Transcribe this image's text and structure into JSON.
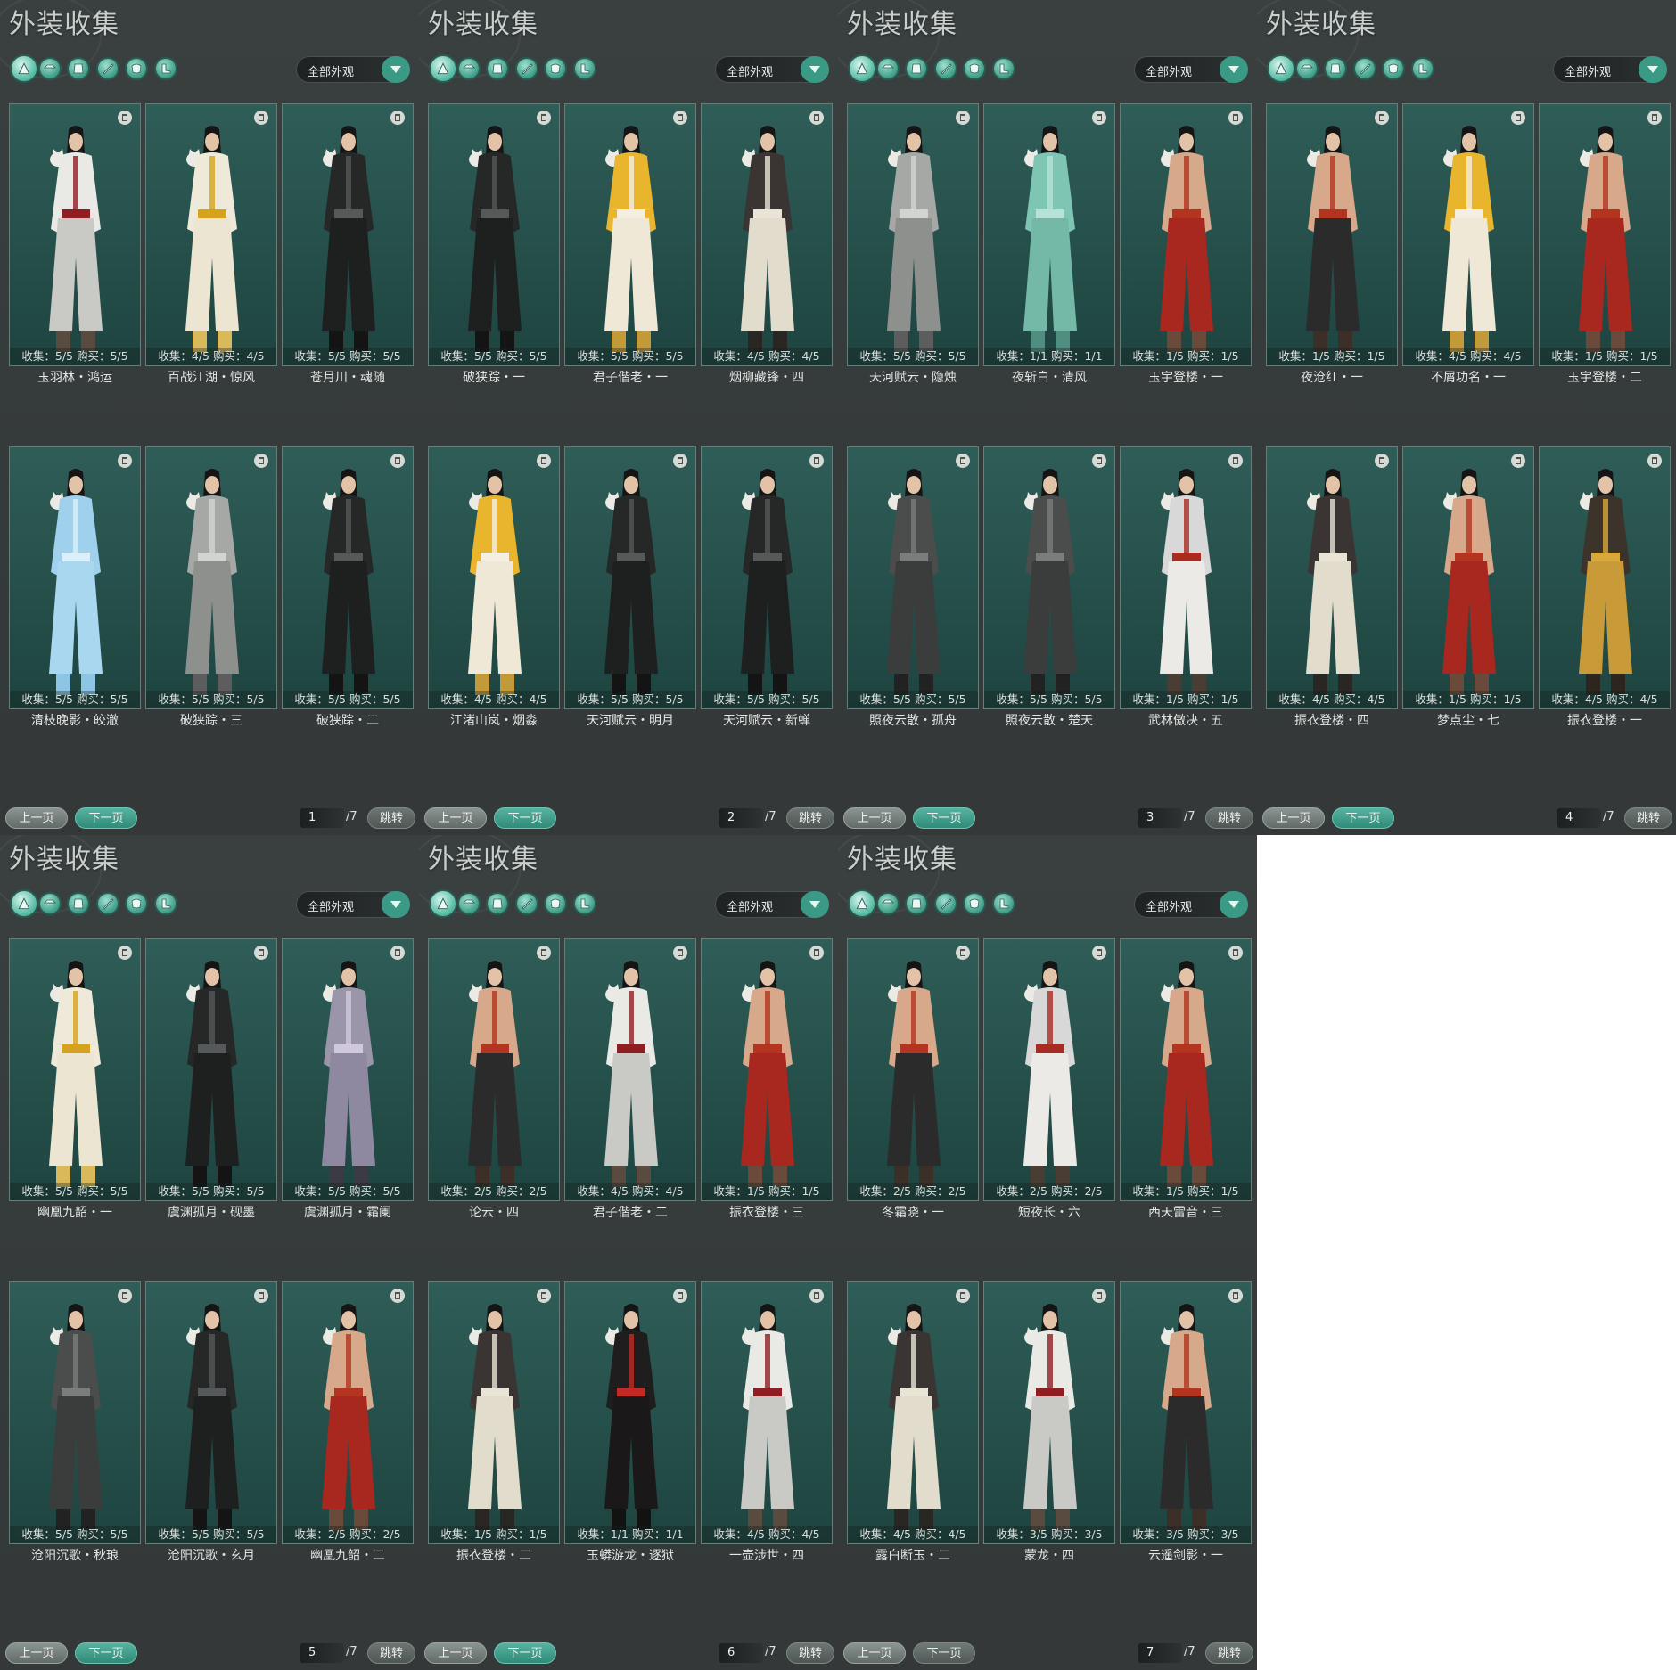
{
  "panel_title": "外装收集",
  "filter_label": "全部外观",
  "prev_label": "上一页",
  "next_label": "下一页",
  "jump_label": "跳转",
  "filter_icons": [
    "all-outfits-icon",
    "hat-icon",
    "top-icon",
    "weapon-icon",
    "mask-icon",
    "shoes-icon"
  ],
  "colors": {
    "accent": "#3a9a86",
    "card_bg": "#2f5d57",
    "panel_bg": "#3a4040"
  },
  "panels": [
    {
      "page": "1",
      "total": "/7",
      "items": [
        {
          "name": "玉羽林・鸿运",
          "collect": "收集：5/5",
          "buy": "购买：5/5",
          "outfit": "white"
        },
        {
          "name": "百战江湖・惊风",
          "collect": "收集：4/5",
          "buy": "购买：4/5",
          "outfit": "whitegold"
        },
        {
          "name": "苍月川・魂随",
          "collect": "收集：5/5",
          "buy": "购买：5/5",
          "outfit": "black"
        },
        {
          "name": "清枝晚影・皎澈",
          "collect": "收集：5/5",
          "buy": "购买：5/5",
          "outfit": "blue"
        },
        {
          "name": "破狭踪・三",
          "collect": "收集：5/5",
          "buy": "购买：5/5",
          "outfit": "grey"
        },
        {
          "name": "破狭踪・二",
          "collect": "收集：5/5",
          "buy": "购买：5/5",
          "outfit": "black"
        }
      ]
    },
    {
      "page": "2",
      "total": "/7",
      "items": [
        {
          "name": "破狭踪・一",
          "collect": "收集：5/5",
          "buy": "购买：5/5",
          "outfit": "black"
        },
        {
          "name": "君子偕老・一",
          "collect": "收集：5/5",
          "buy": "购买：5/5",
          "outfit": "gold"
        },
        {
          "name": "烟柳藏锋・四",
          "collect": "收集：4/5",
          "buy": "购买：4/5",
          "outfit": "darkwhite"
        },
        {
          "name": "江渚山岚・烟淼",
          "collect": "收集：4/5",
          "buy": "购买：4/5",
          "outfit": "gold"
        },
        {
          "name": "天河赋云・明月",
          "collect": "收集：5/5",
          "buy": "购买：5/5",
          "outfit": "black"
        },
        {
          "name": "天河赋云・新蝉",
          "collect": "收集：5/5",
          "buy": "购买：5/5",
          "outfit": "black"
        }
      ]
    },
    {
      "page": "3",
      "total": "/7",
      "items": [
        {
          "name": "天河赋云・隐烛",
          "collect": "收集：5/5",
          "buy": "购买：5/5",
          "outfit": "grey"
        },
        {
          "name": "夜斩白・清风",
          "collect": "收集：1/1",
          "buy": "购买：1/1",
          "outfit": "teal"
        },
        {
          "name": "玉宇登楼・一",
          "collect": "收集：1/5",
          "buy": "购买：1/5",
          "outfit": "redpants"
        },
        {
          "name": "照夜云散・孤舟",
          "collect": "收集：5/5",
          "buy": "购买：5/5",
          "outfit": "darkgrey"
        },
        {
          "name": "照夜云散・楚天",
          "collect": "收集：5/5",
          "buy": "购买：5/5",
          "outfit": "darkgrey"
        },
        {
          "name": "武林傲决・五",
          "collect": "收集：1/5",
          "buy": "购买：1/5",
          "outfit": "whitered"
        }
      ]
    },
    {
      "page": "4",
      "total": "/7",
      "items": [
        {
          "name": "夜沧红・一",
          "collect": "收集：1/5",
          "buy": "购买：1/5",
          "outfit": "bare"
        },
        {
          "name": "不屑功名・一",
          "collect": "收集：4/5",
          "buy": "购买：4/5",
          "outfit": "gold"
        },
        {
          "name": "玉宇登楼・二",
          "collect": "收集：1/5",
          "buy": "购买：1/5",
          "outfit": "redpants"
        },
        {
          "name": "振衣登楼・四",
          "collect": "收集：4/5",
          "buy": "购买：4/5",
          "outfit": "darkwhite"
        },
        {
          "name": "梦点尘・七",
          "collect": "收集：1/5",
          "buy": "购买：1/5",
          "outfit": "redpants"
        },
        {
          "name": "振衣登楼・一",
          "collect": "收集：4/5",
          "buy": "购买：4/5",
          "outfit": "darkgold"
        }
      ]
    },
    {
      "page": "5",
      "total": "/7",
      "items": [
        {
          "name": "幽凰九韶・一",
          "collect": "收集：5/5",
          "buy": "购买：5/5",
          "outfit": "whitegold"
        },
        {
          "name": "虞渊孤月・砚墨",
          "collect": "收集：5/5",
          "buy": "购买：5/5",
          "outfit": "black"
        },
        {
          "name": "虞渊孤月・霜阑",
          "collect": "收集：5/5",
          "buy": "购买：5/5",
          "outfit": "lavender"
        },
        {
          "name": "沧阳沉歌・秋琅",
          "collect": "收集：5/5",
          "buy": "购买：5/5",
          "outfit": "darkgrey"
        },
        {
          "name": "沧阳沉歌・玄月",
          "collect": "收集：5/5",
          "buy": "购买：5/5",
          "outfit": "black"
        },
        {
          "name": "幽凰九韶・二",
          "collect": "收集：2/5",
          "buy": "购买：2/5",
          "outfit": "redpants"
        }
      ]
    },
    {
      "page": "6",
      "total": "/7",
      "items": [
        {
          "name": "论云・四",
          "collect": "收集：2/5",
          "buy": "购买：2/5",
          "outfit": "bare"
        },
        {
          "name": "君子偕老・二",
          "collect": "收集：4/5",
          "buy": "购买：4/5",
          "outfit": "white"
        },
        {
          "name": "振衣登楼・三",
          "collect": "收集：1/5",
          "buy": "购买：1/5",
          "outfit": "redpants"
        },
        {
          "name": "振衣登楼・二",
          "collect": "收集：1/5",
          "buy": "购买：1/5",
          "outfit": "darkwhite"
        },
        {
          "name": "玉蟒游龙・逐狱",
          "collect": "收集：1/1",
          "buy": "购买：1/1",
          "outfit": "blackred"
        },
        {
          "name": "一壶涉世・四",
          "collect": "收集：4/5",
          "buy": "购买：4/5",
          "outfit": "white"
        }
      ]
    },
    {
      "page": "7",
      "total": "/7",
      "items": [
        {
          "name": "冬霜晓・一",
          "collect": "收集：2/5",
          "buy": "购买：2/5",
          "outfit": "bare"
        },
        {
          "name": "短夜长・六",
          "collect": "收集：2/5",
          "buy": "购买：2/5",
          "outfit": "whitered"
        },
        {
          "name": "西天雷音・三",
          "collect": "收集：1/5",
          "buy": "购买：1/5",
          "outfit": "redpants"
        },
        {
          "name": "露白断玉・二",
          "collect": "收集：4/5",
          "buy": "购买：4/5",
          "outfit": "darkwhite"
        },
        {
          "name": "蒙龙・四",
          "collect": "收集：3/5",
          "buy": "购买：3/5",
          "outfit": "white"
        },
        {
          "name": "云遥剑影・一",
          "collect": "收集：3/5",
          "buy": "购买：3/5",
          "outfit": "bare"
        }
      ]
    }
  ]
}
